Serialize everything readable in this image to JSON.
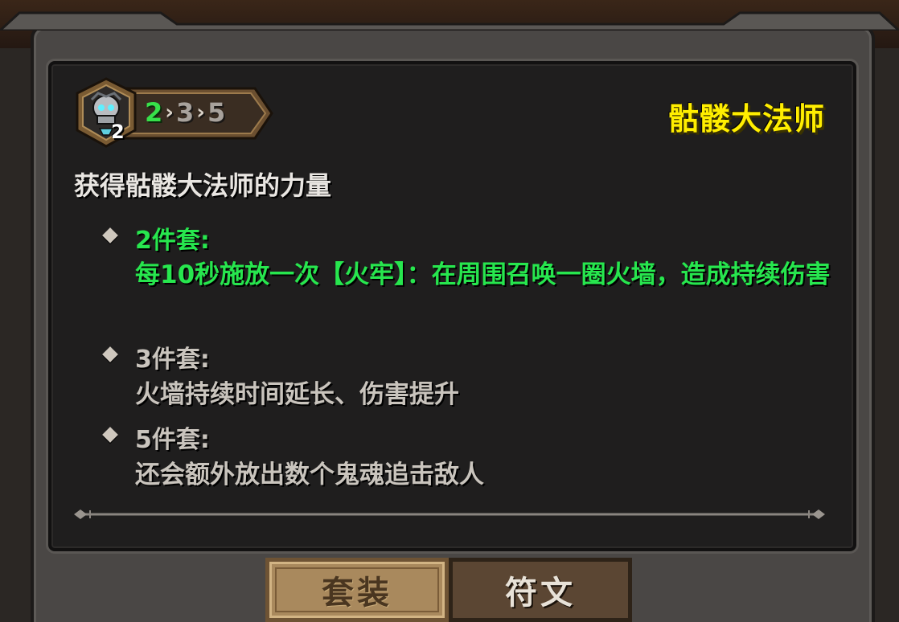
{
  "set": {
    "title": "骷髅大法师",
    "icon": "skull-mage-icon",
    "equipped_count": "2",
    "tier_steps": [
      "2",
      "3",
      "5"
    ],
    "description": "获得骷髅大法师的力量"
  },
  "tiers": [
    {
      "label": "2件套:",
      "effect": "每10秒施放一次【火牢】：在周围召唤一圈火墙，造成持续伤害",
      "active": true
    },
    {
      "label": "3件套:",
      "effect": "火墙持续时间延长、伤害提升",
      "active": false
    },
    {
      "label": "5件套:",
      "effect": "还会额外放出数个鬼魂追击敌人",
      "active": false
    }
  ],
  "tabs": [
    {
      "label": "套装",
      "selected": true
    },
    {
      "label": "符文",
      "selected": false
    }
  ],
  "colors": {
    "title": "#ffee00",
    "active_tier": "#27e64e",
    "inactive_tier": "#c9c4bd",
    "description": "#e9e6e2",
    "panel": "#1f1e1e",
    "tab_active": "#a9895d",
    "tab_inactive": "#5b4633"
  }
}
